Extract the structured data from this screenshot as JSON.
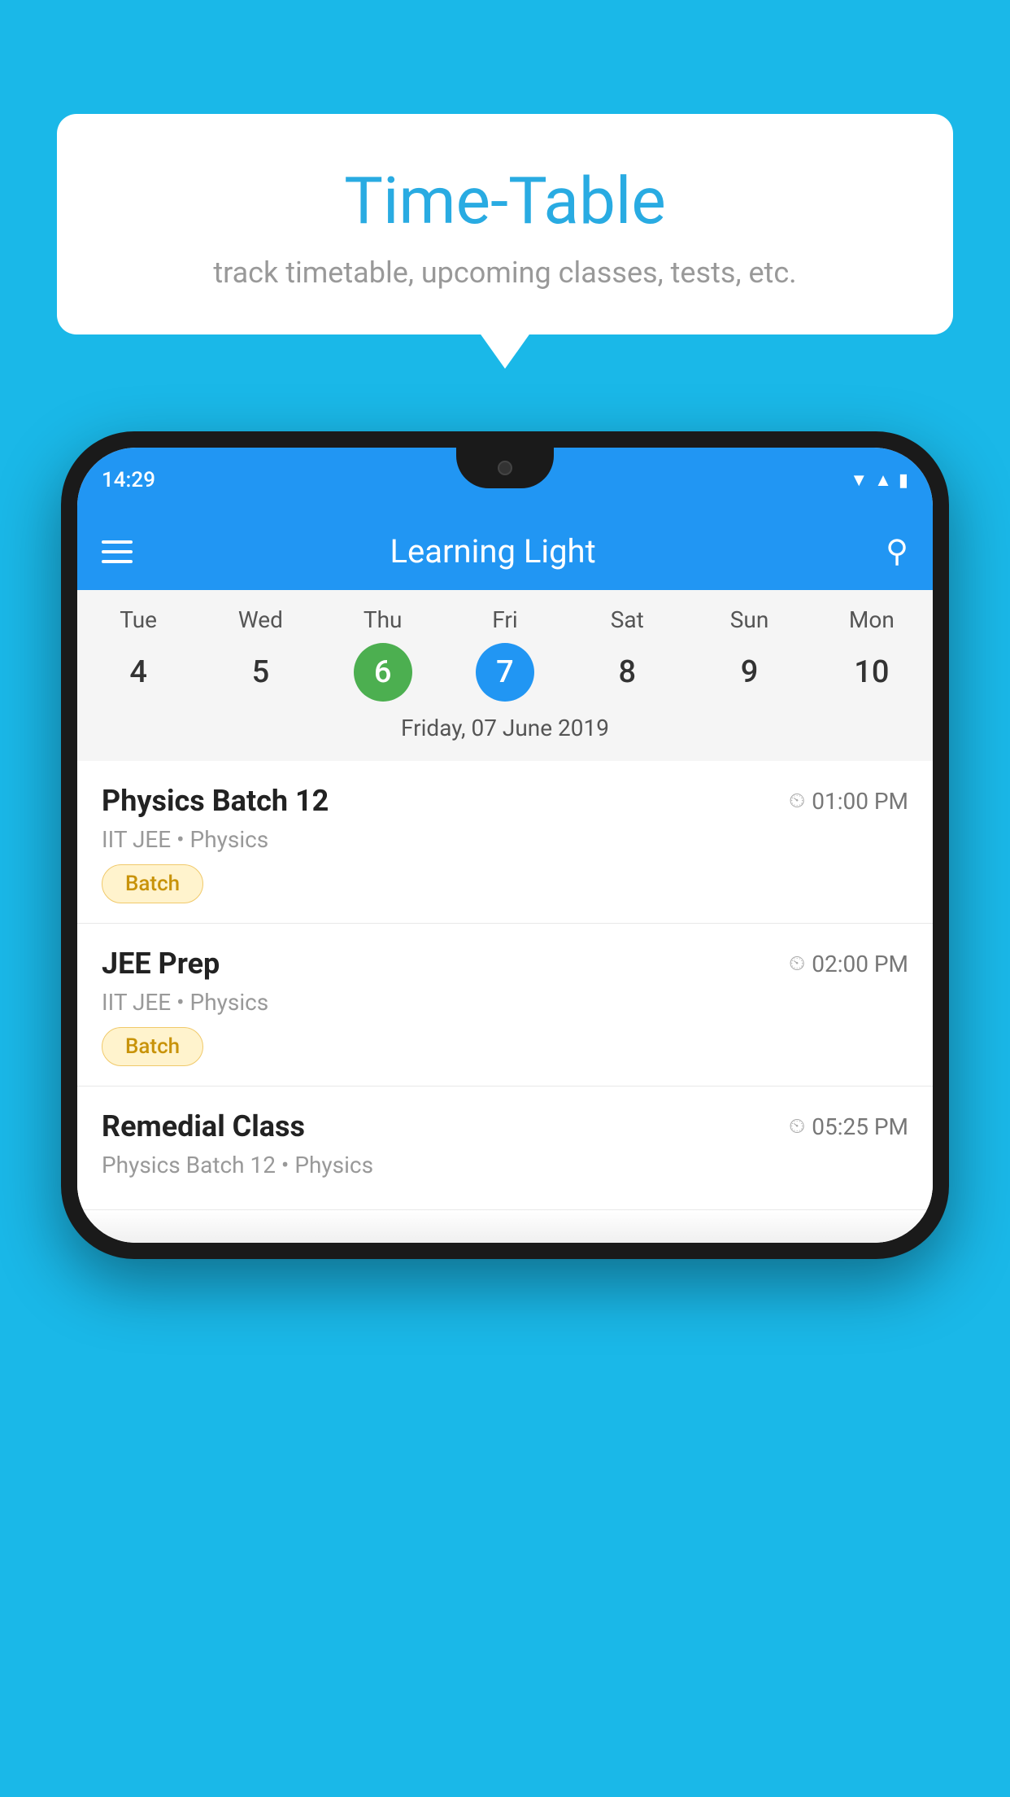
{
  "background_color": "#1ab8e8",
  "tooltip": {
    "title": "Time-Table",
    "subtitle": "track timetable, upcoming classes, tests, etc."
  },
  "phone": {
    "status_bar": {
      "time": "14:29",
      "icons": [
        "wifi",
        "signal",
        "battery"
      ]
    },
    "app_header": {
      "title": "Learning Light",
      "menu_icon": "hamburger-menu",
      "search_icon": "search"
    },
    "calendar": {
      "days": [
        "Tue",
        "Wed",
        "Thu",
        "Fri",
        "Sat",
        "Sun",
        "Mon"
      ],
      "numbers": [
        "4",
        "5",
        "6",
        "7",
        "8",
        "9",
        "10"
      ],
      "today_index": 2,
      "selected_index": 3,
      "selected_date_label": "Friday, 07 June 2019"
    },
    "schedule_items": [
      {
        "title": "Physics Batch 12",
        "time": "01:00 PM",
        "meta": "IIT JEE • Physics",
        "tag": "Batch"
      },
      {
        "title": "JEE Prep",
        "time": "02:00 PM",
        "meta": "IIT JEE • Physics",
        "tag": "Batch"
      },
      {
        "title": "Remedial Class",
        "time": "05:25 PM",
        "meta": "Physics Batch 12 • Physics",
        "tag": null
      }
    ]
  }
}
